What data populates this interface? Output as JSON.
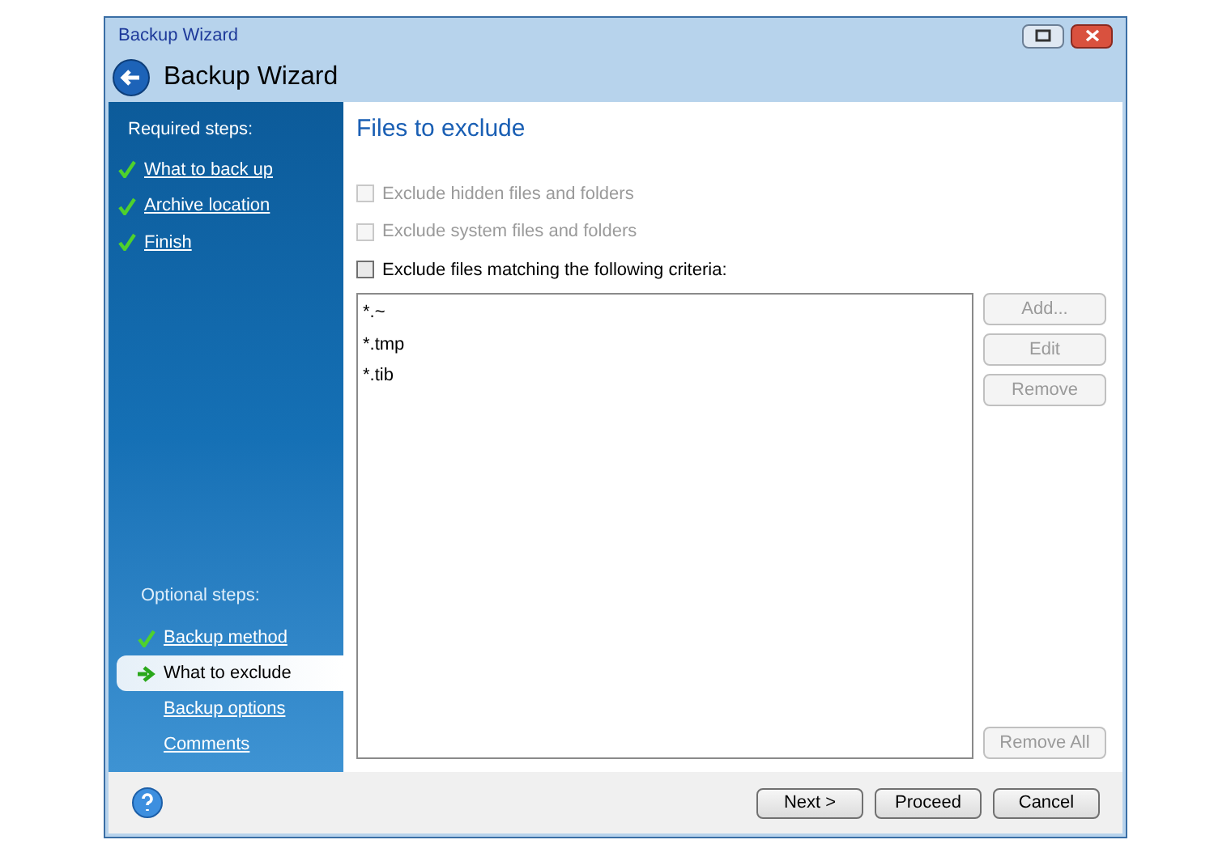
{
  "window": {
    "title": "Backup Wizard"
  },
  "header": {
    "title": "Backup Wizard"
  },
  "sidebar": {
    "required_heading": "Required steps:",
    "required_steps": [
      {
        "label": "What to back up",
        "completed": true
      },
      {
        "label": "Archive location",
        "completed": true
      },
      {
        "label": "Finish",
        "completed": true
      }
    ],
    "optional_heading": "Optional steps:",
    "optional_steps": [
      {
        "label": "Backup method",
        "completed": true,
        "selected": false
      },
      {
        "label": "What to exclude",
        "completed": false,
        "selected": true
      },
      {
        "label": "Backup options",
        "completed": false,
        "selected": false
      },
      {
        "label": "Comments",
        "completed": false,
        "selected": false
      }
    ]
  },
  "page_title": "Files to exclude",
  "options": [
    {
      "label": "Exclude hidden files and folders",
      "checked": false,
      "disabled": true
    },
    {
      "label": "Exclude system files and folders",
      "checked": false,
      "disabled": true
    },
    {
      "label": "Exclude files matching the following criteria:",
      "checked": false,
      "disabled": false
    }
  ],
  "criteria": [
    "*.~",
    "*.tmp",
    "*.tib"
  ],
  "side_buttons": [
    {
      "label": "Add...",
      "disabled": true
    },
    {
      "label": "Edit",
      "disabled": true
    },
    {
      "label": "Remove",
      "disabled": true
    }
  ],
  "remove_all": {
    "label": "Remove All",
    "disabled": true
  },
  "footer_buttons": [
    "Next >",
    "Proceed",
    "Cancel"
  ]
}
